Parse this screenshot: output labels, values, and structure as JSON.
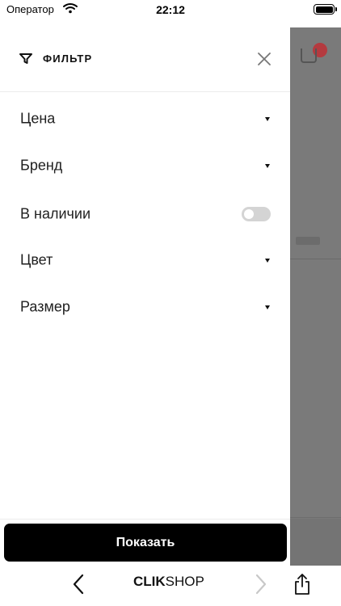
{
  "status_bar": {
    "carrier": "Оператор",
    "time": "22:12"
  },
  "filter_panel": {
    "title": "ФИЛЬТР",
    "items": [
      {
        "label": "Цена",
        "control": "dropdown"
      },
      {
        "label": "Бренд",
        "control": "dropdown"
      },
      {
        "label": "В наличии",
        "control": "toggle",
        "enabled": false
      },
      {
        "label": "Цвет",
        "control": "dropdown"
      },
      {
        "label": "Размер",
        "control": "dropdown"
      }
    ],
    "apply_label": "Показать"
  },
  "browser_bar": {
    "brand_bold": "CLIK",
    "brand_regular": "SHOP"
  },
  "icons": {
    "filter": "filter-icon",
    "close": "close-icon",
    "back": "chevron-left-icon",
    "forward": "chevron-right-icon",
    "share": "share-icon",
    "wifi": "wifi-icon",
    "battery": "battery-icon"
  },
  "colors": {
    "overlay": "#7a7a7a",
    "button": "#000000",
    "toggle_off": "#d4d4d4",
    "badge": "#b43a3f"
  }
}
